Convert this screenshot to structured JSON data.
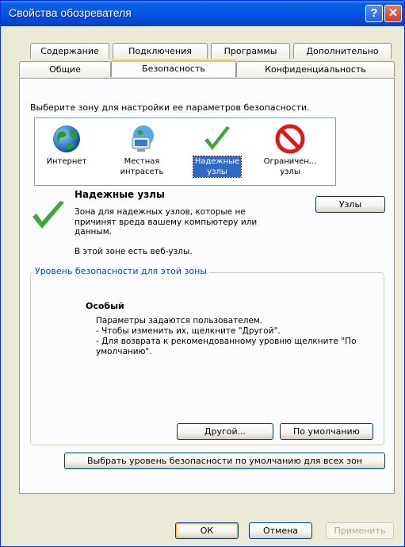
{
  "window": {
    "title": "Свойства обозревателя"
  },
  "tabs": {
    "row1": [
      {
        "label": "Содержание"
      },
      {
        "label": "Подключения"
      },
      {
        "label": "Программы"
      },
      {
        "label": "Дополнительно"
      }
    ],
    "row2": [
      {
        "label": "Общие"
      },
      {
        "label": "Безопасность"
      },
      {
        "label": "Конфиденциальность"
      }
    ]
  },
  "security": {
    "zone_prompt": "Выберите зону для настройки ее параметров безопасности.",
    "zones": [
      {
        "label": "Интернет",
        "icon": "globe-icon"
      },
      {
        "label": "Местная интрасеть",
        "icon": "intranet-icon"
      },
      {
        "label": "Надежные узлы",
        "icon": "checkmark-icon",
        "selected": true
      },
      {
        "label": "Ограничен... узлы",
        "icon": "restricted-icon"
      }
    ],
    "selected_zone": {
      "title": "Надежные узлы",
      "description": "Зона для надежных узлов, которые не причинят вреда вашему компьютеру или данным.",
      "sites_note": "В этой зоне есть веб-узлы.",
      "sites_button": "Узлы"
    },
    "level_group": {
      "legend": "Уровень безопасности для этой зоны",
      "level_name": "Особый",
      "lines": [
        "Параметры задаются пользователем.",
        "- Чтобы изменить их, щелкните \"Другой\".",
        "- Для возврата к рекомендованному уровню щелкните \"По умолчанию\"."
      ],
      "custom_button": "Другой...",
      "default_button": "По умолчанию"
    },
    "reset_all_button": "Выбрать уровень безопасности по умолчанию для всех зон"
  },
  "footer": {
    "ok": "ОК",
    "cancel": "Отмена",
    "apply": "Применить"
  },
  "colors": {
    "titlebar": "#0656e6",
    "selection": "#316ac5",
    "legend": "#0046d5",
    "active_tab_accent": "#ffc83c"
  }
}
